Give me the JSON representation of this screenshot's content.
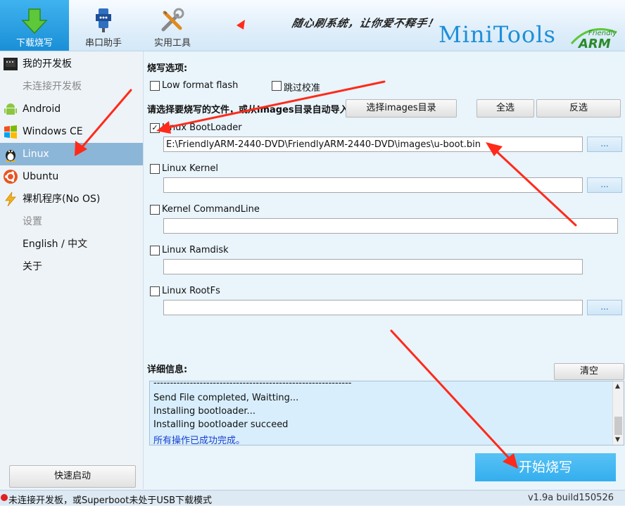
{
  "window": {
    "minimize": "—",
    "close": "✕"
  },
  "header": {
    "tabs": [
      {
        "label": "下载烧写",
        "icon": "download-arrow-icon",
        "active": true
      },
      {
        "label": "串口助手",
        "icon": "serial-connector-icon",
        "active": false
      },
      {
        "label": "实用工具",
        "icon": "tools-icon",
        "active": false
      }
    ],
    "slogan": "随心刷系统，让你爱不释手！",
    "brand": "MiniTools",
    "logo_text": "Friendly ARM"
  },
  "sidebar": {
    "items": [
      {
        "label": "我的开发板",
        "icon": "board-icon",
        "disabled": false,
        "active": false
      },
      {
        "label": "未连接开发板",
        "icon": "",
        "disabled": true,
        "active": false
      },
      {
        "label": "Android",
        "icon": "android-icon",
        "disabled": false,
        "active": false
      },
      {
        "label": "Windows CE",
        "icon": "windows-icon",
        "disabled": false,
        "active": false
      },
      {
        "label": "Linux",
        "icon": "tux-icon",
        "disabled": false,
        "active": true
      },
      {
        "label": "Ubuntu",
        "icon": "ubuntu-icon",
        "disabled": false,
        "active": false
      },
      {
        "label": "裸机程序(No OS)",
        "icon": "lightning-icon",
        "disabled": false,
        "active": false
      },
      {
        "label": "设置",
        "icon": "",
        "disabled": true,
        "active": false
      },
      {
        "label": "English / 中文",
        "icon": "",
        "disabled": false,
        "active": false
      },
      {
        "label": "关于",
        "icon": "",
        "disabled": false,
        "active": false
      }
    ],
    "quick_start": "快速启动"
  },
  "main": {
    "options_title": "烧写选项:",
    "low_format": {
      "label": "Low format flash",
      "checked": false
    },
    "skip_verify": {
      "label": "跳过校准",
      "checked": false
    },
    "select_prompt": "请选择要烧写的文件，或从images目录自动导入",
    "select_images_btn": "选择images目录",
    "select_all_btn": "全选",
    "invert_btn": "反选",
    "files": [
      {
        "label": "Linux BootLoader",
        "checked": true,
        "path": "E:\\FriendlyARM-2440-DVD\\FriendlyARM-2440-DVD\\images\\u-boot.bin",
        "browse": "..."
      },
      {
        "label": "Linux Kernel",
        "checked": false,
        "path": "",
        "browse": "..."
      },
      {
        "label": "Kernel CommandLine",
        "checked": false,
        "path": ""
      },
      {
        "label": "Linux Ramdisk",
        "checked": false,
        "path": ""
      },
      {
        "label": "Linux RootFs",
        "checked": false,
        "path": "",
        "browse": "..."
      }
    ],
    "details_title": "详细信息:",
    "clear_btn": "清空",
    "log": [
      {
        "text": "------------------------------------------------------------",
        "color": "#111111"
      },
      {
        "text": "Send File completed, Waitting...",
        "color": "#111111"
      },
      {
        "text": "Installing bootloader...",
        "color": "#111111"
      },
      {
        "text": "Installing bootloader succeed",
        "color": "#111111"
      },
      {
        "text": "所有操作已成功完成。",
        "color": "#1a3fd0"
      }
    ],
    "start_btn": "开始烧写"
  },
  "statusbar": {
    "text": "未连接开发板，或Superboot未处于USB下载模式",
    "version": "v1.9a build150526"
  },
  "colors": {
    "accent": "#34aeee",
    "annotation_arrow": "#ff2a1a",
    "status_dot": "#e02020"
  }
}
